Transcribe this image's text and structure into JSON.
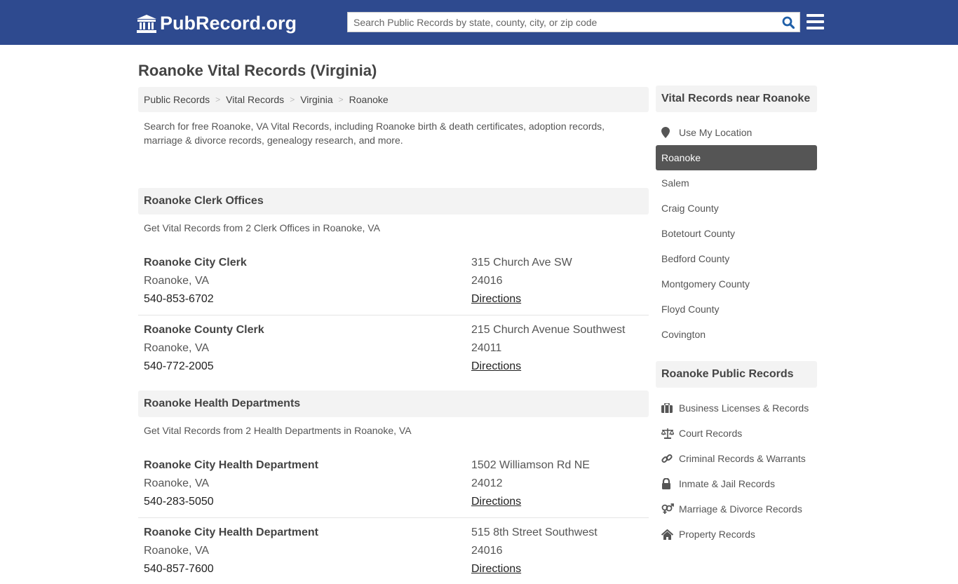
{
  "header": {
    "logo_text": "PubRecord.org",
    "search_placeholder": "Search Public Records by state, county, city, or zip code"
  },
  "page_title": "Roanoke Vital Records (Virginia)",
  "breadcrumb": [
    "Public Records",
    "Vital Records",
    "Virginia",
    "Roanoke"
  ],
  "intro": "Search for free Roanoke, VA Vital Records, including Roanoke birth & death certificates, adoption records, marriage & divorce records, genealogy research, and more.",
  "sections": [
    {
      "title": "Roanoke Clerk Offices",
      "description": "Get Vital Records from 2 Clerk Offices in Roanoke, VA",
      "offices": [
        {
          "name": "Roanoke City Clerk",
          "city": "Roanoke, VA",
          "phone": "540-853-6702",
          "address": "315 Church Ave SW",
          "zip": "24016",
          "directions": "Directions"
        },
        {
          "name": "Roanoke County Clerk",
          "city": "Roanoke, VA",
          "phone": "540-772-2005",
          "address": "215 Church Avenue Southwest",
          "zip": "24011",
          "directions": "Directions"
        }
      ]
    },
    {
      "title": "Roanoke Health Departments",
      "description": "Get Vital Records from 2 Health Departments in Roanoke, VA",
      "offices": [
        {
          "name": "Roanoke City Health Department",
          "city": "Roanoke, VA",
          "phone": "540-283-5050",
          "address": "1502 Williamson Rd NE",
          "zip": "24012",
          "directions": "Directions"
        },
        {
          "name": "Roanoke City Health Department",
          "city": "Roanoke, VA",
          "phone": "540-857-7600",
          "address": "515 8th Street Southwest",
          "zip": "24016",
          "directions": "Directions"
        }
      ]
    }
  ],
  "sidebar": {
    "nearby_title": "Vital Records near Roanoke",
    "use_location": "Use My Location",
    "nearby": [
      "Roanoke",
      "Salem",
      "Craig County",
      "Botetourt County",
      "Bedford County",
      "Montgomery County",
      "Floyd County",
      "Covington"
    ],
    "active_index": 0,
    "public_title": "Roanoke Public Records",
    "public_records": [
      {
        "label": "Business Licenses & Records",
        "icon": "briefcase-icon"
      },
      {
        "label": "Court Records",
        "icon": "balance-scale-icon"
      },
      {
        "label": "Criminal Records & Warrants",
        "icon": "link-icon"
      },
      {
        "label": "Inmate & Jail Records",
        "icon": "lock-icon"
      },
      {
        "label": "Marriage & Divorce Records",
        "icon": "venus-mars-icon"
      },
      {
        "label": "Property Records",
        "icon": "home-icon"
      }
    ]
  },
  "colors": {
    "header_bg": "#2e4a8f",
    "search_icon": "#1f5fa8",
    "active_bg": "#555555"
  }
}
